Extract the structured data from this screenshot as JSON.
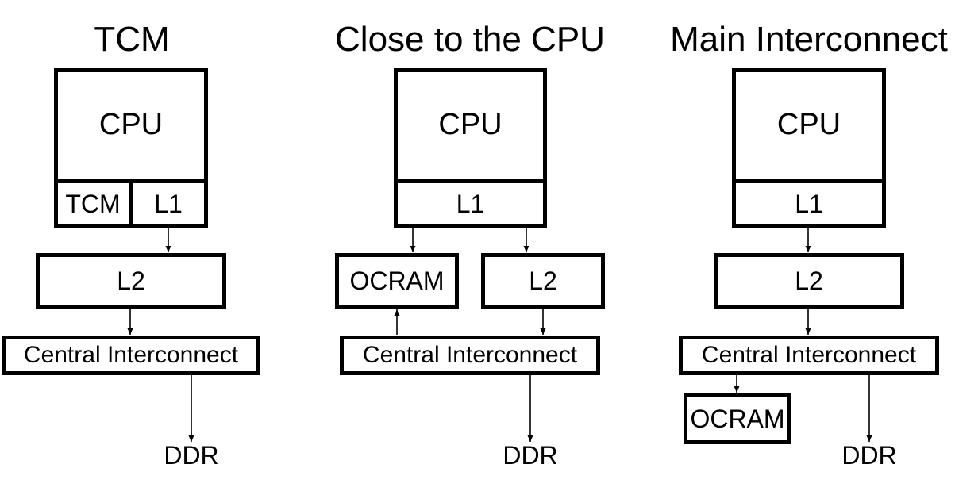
{
  "diagram": {
    "panels": [
      {
        "title": "TCM",
        "cpu": "CPU",
        "tcm": "TCM",
        "l1": "L1",
        "l2": "L2",
        "interconnect": "Central Interconnect",
        "ddr": "DDR"
      },
      {
        "title": "Close to the CPU",
        "cpu": "CPU",
        "l1": "L1",
        "ocram": "OCRAM",
        "l2": "L2",
        "interconnect": "Central Interconnect",
        "ddr": "DDR"
      },
      {
        "title": "Main Interconnect",
        "cpu": "CPU",
        "l1": "L1",
        "l2": "L2",
        "interconnect": "Central Interconnect",
        "ocram": "OCRAM",
        "ddr": "DDR"
      }
    ],
    "connections": [
      {
        "panel": 0,
        "from": "L1",
        "to": "L2"
      },
      {
        "panel": 0,
        "from": "L2",
        "to": "Central Interconnect"
      },
      {
        "panel": 0,
        "from": "Central Interconnect",
        "to": "DDR"
      },
      {
        "panel": 1,
        "from": "L1",
        "to": "OCRAM"
      },
      {
        "panel": 1,
        "from": "L1",
        "to": "L2"
      },
      {
        "panel": 1,
        "from": "Central Interconnect",
        "to": "OCRAM"
      },
      {
        "panel": 1,
        "from": "L2",
        "to": "Central Interconnect"
      },
      {
        "panel": 1,
        "from": "Central Interconnect",
        "to": "DDR"
      },
      {
        "panel": 2,
        "from": "L1",
        "to": "L2"
      },
      {
        "panel": 2,
        "from": "L2",
        "to": "Central Interconnect"
      },
      {
        "panel": 2,
        "from": "Central Interconnect",
        "to": "OCRAM"
      },
      {
        "panel": 2,
        "from": "Central Interconnect",
        "to": "DDR"
      }
    ]
  }
}
